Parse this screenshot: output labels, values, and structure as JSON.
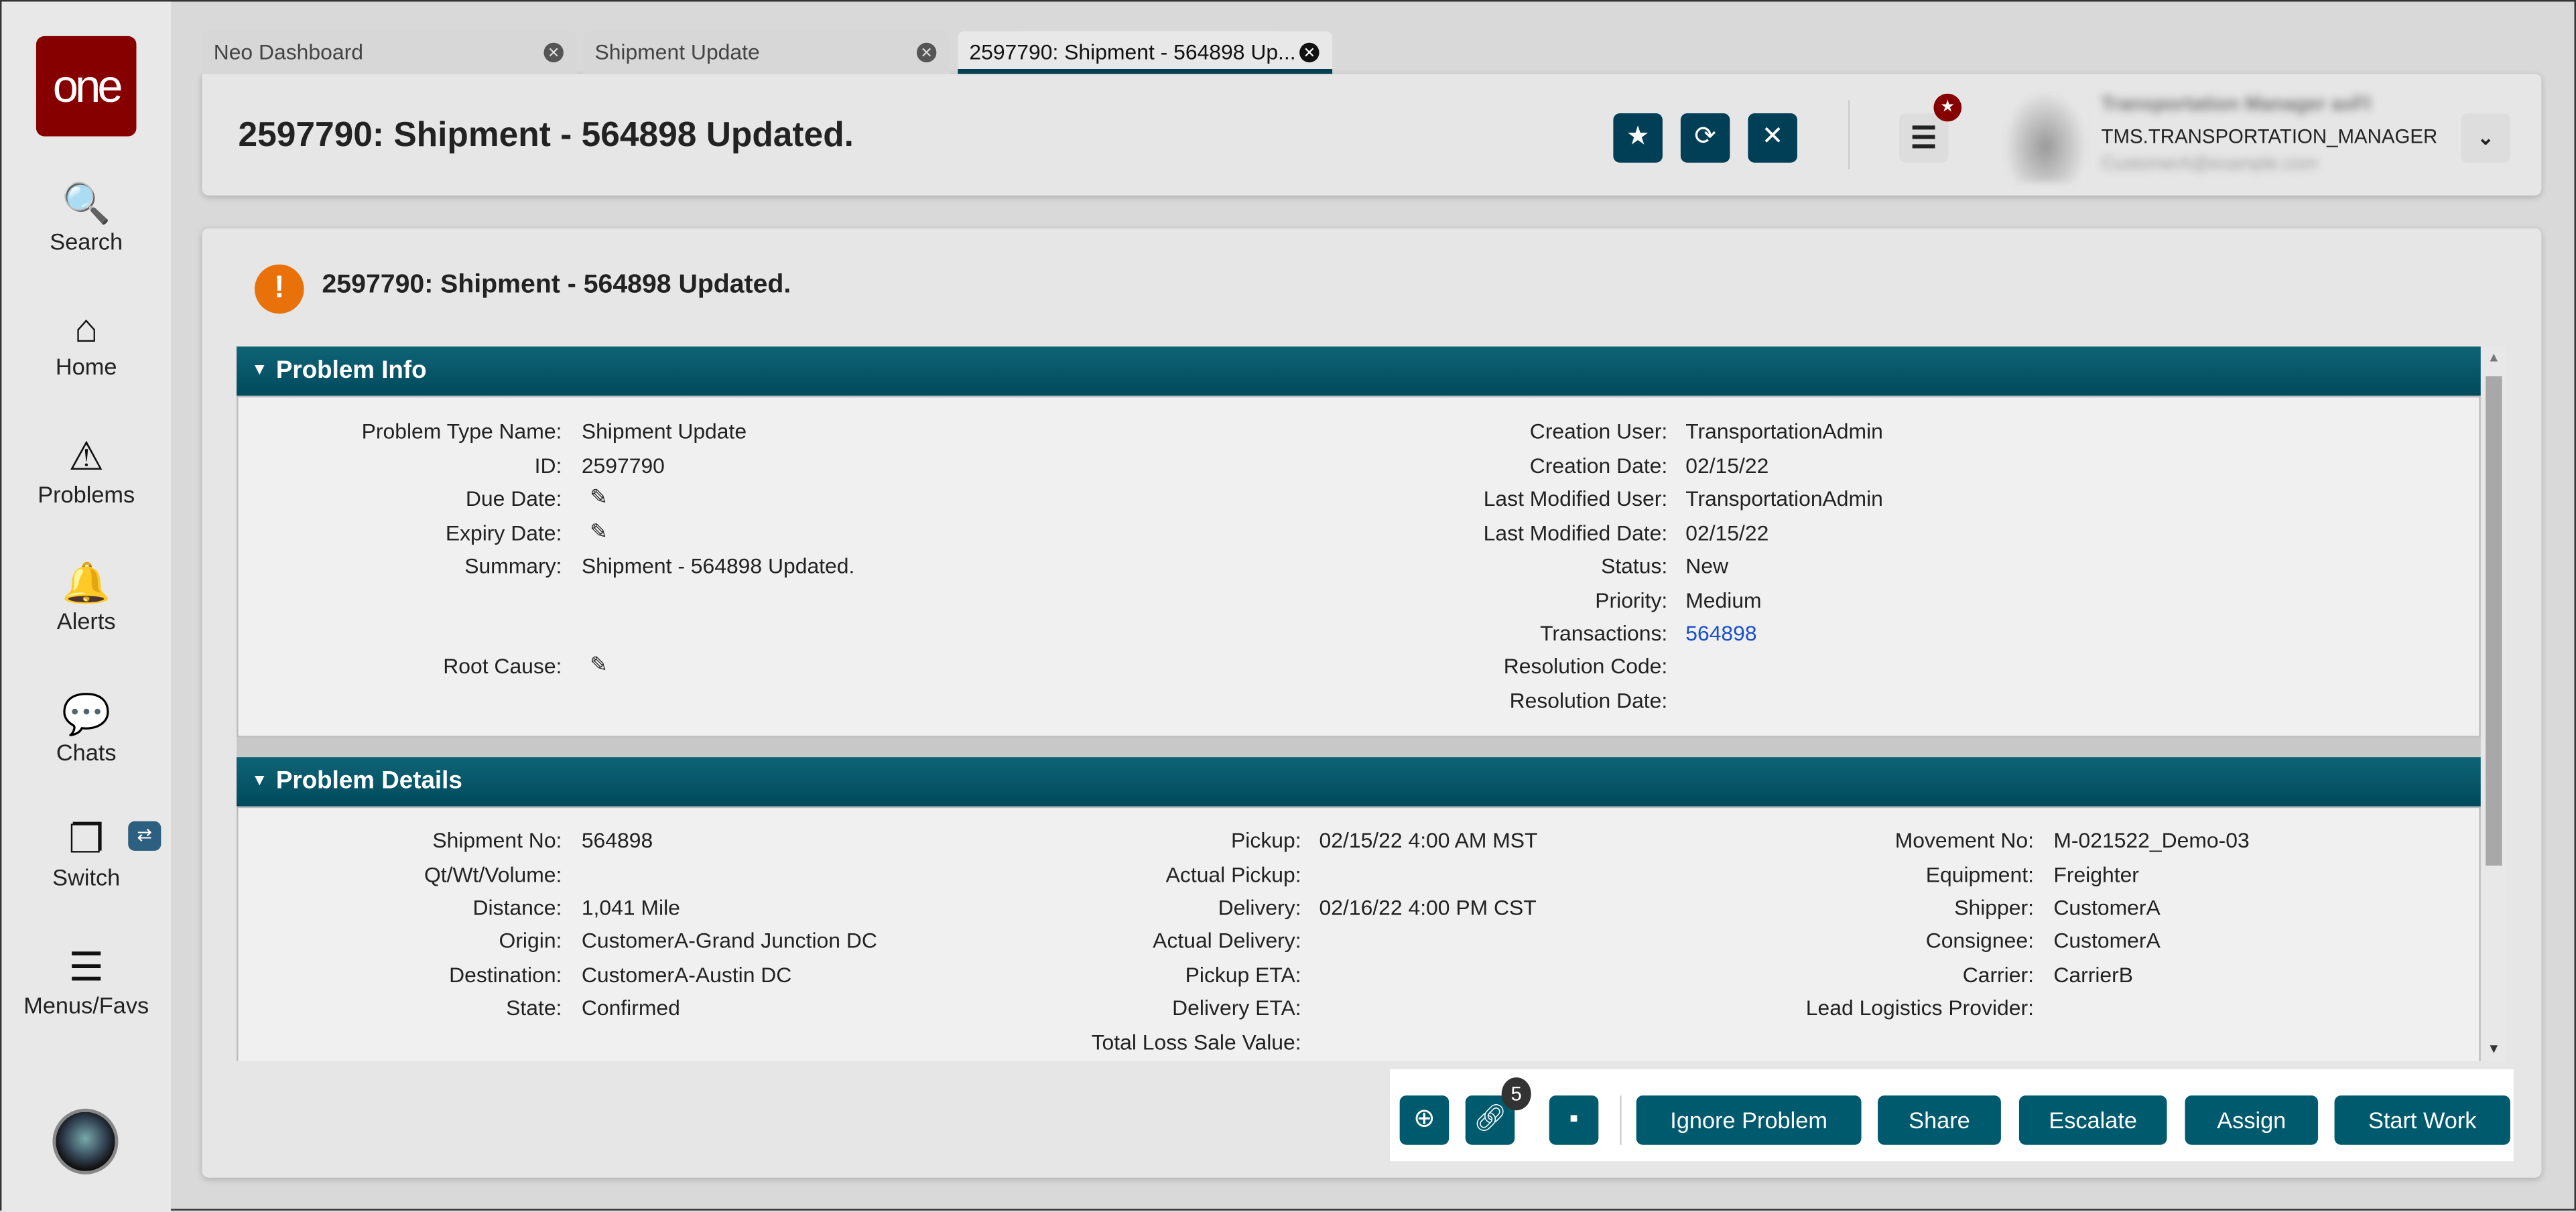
{
  "sidebar": {
    "logo": "one",
    "items": [
      {
        "label": "Search",
        "icon": "search-icon",
        "glyph": "🔍"
      },
      {
        "label": "Home",
        "icon": "home-icon",
        "glyph": "⌂"
      },
      {
        "label": "Problems",
        "icon": "warning-icon",
        "glyph": "⚠"
      },
      {
        "label": "Alerts",
        "icon": "bell-icon",
        "glyph": "🔔"
      },
      {
        "label": "Chats",
        "icon": "chat-icon",
        "glyph": "💬"
      },
      {
        "label": "Switch",
        "icon": "switch-icon",
        "glyph": "❐"
      },
      {
        "label": "Menus/Favs",
        "icon": "menu-icon",
        "glyph": "☰"
      }
    ],
    "switch_badge": "⇄"
  },
  "tabs": [
    {
      "label": "Neo Dashboard"
    },
    {
      "label": "Shipment Update"
    },
    {
      "label": "2597790: Shipment - 564898 Up..."
    }
  ],
  "header": {
    "title": "2597790: Shipment - 564898 Updated.",
    "user_role": "TMS.TRANSPORTATION_MANAGER",
    "user_name": "Transportation Manager axFl",
    "user_email": "CustomerA@example.com"
  },
  "content": {
    "title": "2597790: Shipment - 564898 Updated."
  },
  "problem_info": {
    "title": "Problem Info",
    "left": [
      [
        "Problem Type Name:",
        "Shipment Update"
      ],
      [
        "ID:",
        "2597790"
      ],
      [
        "Due Date:",
        ""
      ],
      [
        "Expiry Date:",
        ""
      ],
      [
        "Summary:",
        "Shipment - 564898 Updated."
      ],
      [
        "Root Cause:",
        ""
      ]
    ],
    "right": [
      [
        "Creation User:",
        "TransportationAdmin"
      ],
      [
        "Creation Date:",
        "02/15/22"
      ],
      [
        "Last Modified User:",
        "TransportationAdmin"
      ],
      [
        "Last Modified Date:",
        "02/15/22"
      ],
      [
        "Status:",
        "New"
      ],
      [
        "Priority:",
        "Medium"
      ],
      [
        "Transactions:",
        "564898"
      ],
      [
        "Resolution Code:",
        ""
      ],
      [
        "Resolution Date:",
        ""
      ]
    ]
  },
  "problem_details": {
    "title": "Problem Details",
    "col1": [
      [
        "Shipment No:",
        "564898"
      ],
      [
        "Qt/Wt/Volume:",
        ""
      ],
      [
        "Distance:",
        "1,041 Mile"
      ],
      [
        "Origin:",
        "CustomerA-Grand Junction DC"
      ],
      [
        "Destination:",
        "CustomerA-Austin DC"
      ],
      [
        "State:",
        "Confirmed"
      ]
    ],
    "col2": [
      [
        "Pickup:",
        "02/15/22 4:00 AM MST"
      ],
      [
        "Actual Pickup:",
        ""
      ],
      [
        "Delivery:",
        "02/16/22 4:00 PM CST"
      ],
      [
        "Actual Delivery:",
        ""
      ],
      [
        "Pickup ETA:",
        ""
      ],
      [
        "Delivery ETA:",
        ""
      ],
      [
        "Total Loss Sale Value:",
        ""
      ]
    ],
    "col3": [
      [
        "Movement No:",
        "M-021522_Demo-03"
      ],
      [
        "Equipment:",
        "Freighter"
      ],
      [
        "Shipper:",
        "CustomerA"
      ],
      [
        "Consignee:",
        "CustomerA"
      ],
      [
        "Carrier:",
        "CarrierB"
      ],
      [
        "Lead Logistics Provider:",
        ""
      ]
    ]
  },
  "footer": {
    "link_count": "5",
    "buttons": [
      "Ignore Problem",
      "Share",
      "Escalate",
      "Assign",
      "Start Work"
    ]
  }
}
